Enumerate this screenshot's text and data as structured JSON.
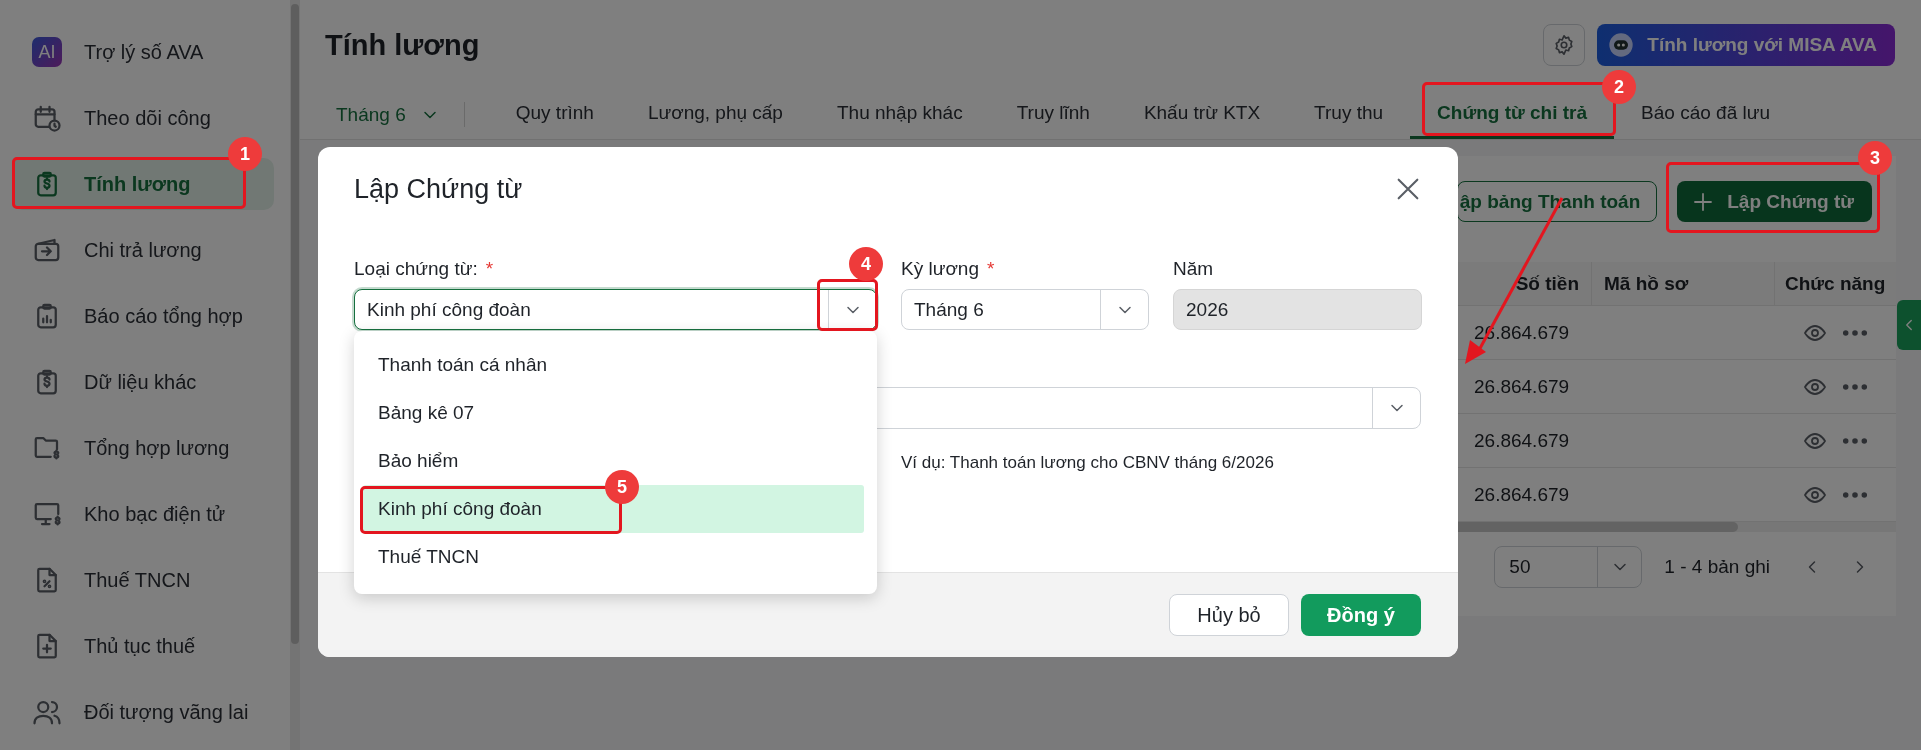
{
  "sidebar": {
    "items": [
      {
        "label": "Trợ lý số AVA",
        "icon_text": "AI",
        "selected": false
      },
      {
        "label": "Theo dõi công",
        "selected": false
      },
      {
        "label": "Tính lương",
        "selected": true
      },
      {
        "label": "Chi trả lương",
        "selected": false
      },
      {
        "label": "Báo cáo tổng hợp",
        "selected": false
      },
      {
        "label": "Dữ liệu khác",
        "selected": false
      },
      {
        "label": "Tổng hợp lương",
        "selected": false
      },
      {
        "label": "Kho bạc điện tử",
        "selected": false
      },
      {
        "label": "Thuế TNCN",
        "selected": false
      },
      {
        "label": "Thủ tục thuế",
        "selected": false
      },
      {
        "label": "Đối tượng vãng lai",
        "selected": false
      }
    ]
  },
  "header": {
    "title": "Tính lương",
    "ava_button": "Tính lương với MISA AVA"
  },
  "tabs": {
    "period": "Tháng 6",
    "items": [
      {
        "label": "Quy trình",
        "selected": false
      },
      {
        "label": "Lương, phụ cấp",
        "selected": false
      },
      {
        "label": "Thu nhập khác",
        "selected": false
      },
      {
        "label": "Truy lĩnh",
        "selected": false
      },
      {
        "label": "Khấu trừ KTX",
        "selected": false
      },
      {
        "label": "Truy thu",
        "selected": false
      },
      {
        "label": "Chứng từ chi trả",
        "selected": true
      },
      {
        "label": "Báo cáo đã lưu",
        "selected": false
      }
    ]
  },
  "toolbar": {
    "buttons": [
      {
        "label": "ập bảng Thanh toán",
        "kind": "outline"
      },
      {
        "label": "Lập Chứng từ",
        "kind": "primary"
      }
    ]
  },
  "table": {
    "columns": [
      "Số tiền",
      "Mã hồ sơ",
      "Chức năng"
    ],
    "rows": [
      {
        "amount": "26.864.679"
      },
      {
        "amount": "26.864.679"
      },
      {
        "amount": "26.864.679"
      },
      {
        "amount": "26.864.679"
      }
    ]
  },
  "pagination": {
    "page_size": "50",
    "range": "1 - 4 bản ghi"
  },
  "dialog": {
    "title": "Lập Chứng từ",
    "fields": [
      {
        "label": "Loại chứng từ:",
        "required_mark": "*",
        "value": "Kinh phí công đoàn",
        "kind": "select",
        "focused": true
      },
      {
        "label": "Kỳ lương",
        "required_mark": "*",
        "value": "Tháng 6",
        "kind": "select",
        "focused": false
      },
      {
        "label": "Năm",
        "value": "2026",
        "kind": "readonly",
        "focused": false
      }
    ],
    "hint": "Ví dụ: Thanh toán lương cho CBNV tháng 6/2026",
    "dropdown": {
      "options": [
        {
          "label": "Thanh toán cá nhân",
          "selected": false
        },
        {
          "label": "Bảng kê 07",
          "selected": false
        },
        {
          "label": "Bảo hiểm",
          "selected": false
        },
        {
          "label": "Kinh phí công đoàn",
          "selected": true
        },
        {
          "label": "Thuế TNCN",
          "selected": false
        }
      ]
    },
    "buttons": [
      {
        "label": "Hủy bỏ",
        "kind": "secondary"
      },
      {
        "label": "Đồng ý",
        "kind": "primary"
      }
    ]
  },
  "annotations": [
    {
      "number": "1"
    },
    {
      "number": "2"
    },
    {
      "number": "3"
    },
    {
      "number": "4"
    },
    {
      "number": "5"
    }
  ]
}
